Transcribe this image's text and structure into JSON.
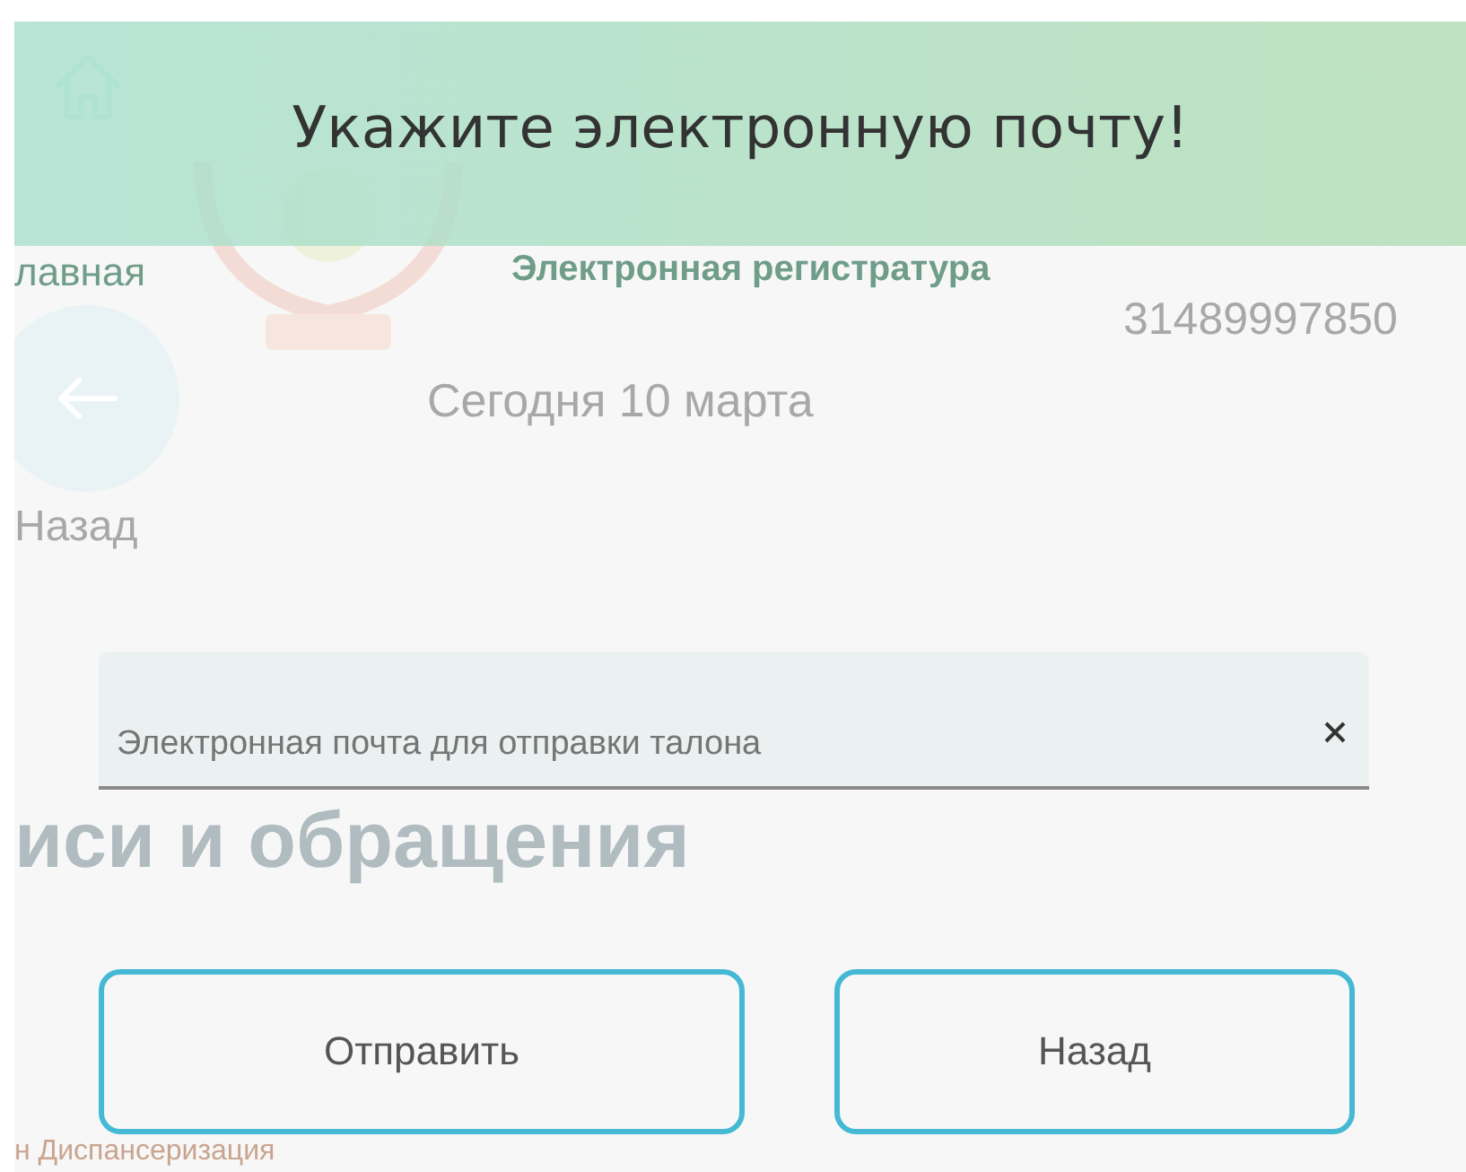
{
  "background": {
    "nav_home_label": "лавная",
    "site_title": "Электронная регистратура",
    "phone": "31489997850",
    "date": "Сегодня 10 марта",
    "back_label": "Назад",
    "section_heading": "иси и обращения",
    "list_item": "н Диспансеризация"
  },
  "dialog": {
    "title": "Укажите электронную почту!",
    "email_field": {
      "placeholder": "Электронная почта для отправки талона"
    },
    "buttons": [
      "Отправить",
      "Назад"
    ]
  }
}
